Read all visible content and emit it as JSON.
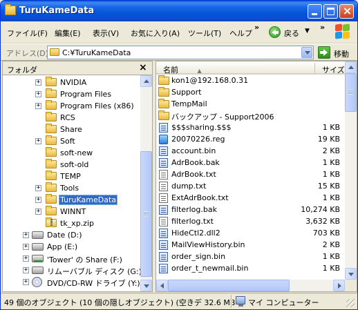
{
  "window": {
    "title": "TuruKameData"
  },
  "menubar": {
    "items": [
      "ファイル(F)",
      "編集(E)",
      "表示(V)",
      "お気に入り(A)",
      "ツール(T)",
      "ヘルプ"
    ],
    "more": "»",
    "back_label": "戻る",
    "back_drop": "▼",
    "more2": "»"
  },
  "addressbar": {
    "label": "アドレス(D)",
    "value": "C:¥TuruKameData",
    "go_label": "移動"
  },
  "folder_pane": {
    "title": "フォルダ",
    "close": "×",
    "items": [
      {
        "label": "NVIDIA",
        "expander": "+",
        "icon": "folder-icon"
      },
      {
        "label": "Program Files",
        "expander": "+",
        "icon": "folder-icon"
      },
      {
        "label": "Program Files (x86)",
        "expander": "+",
        "icon": "folder-icon"
      },
      {
        "label": "RCS",
        "expander": "",
        "icon": "folder-icon"
      },
      {
        "label": "Share",
        "expander": "",
        "icon": "folder-icon"
      },
      {
        "label": "Soft",
        "expander": "+",
        "icon": "folder-icon"
      },
      {
        "label": "soft-new",
        "expander": "",
        "icon": "folder-icon"
      },
      {
        "label": "soft-old",
        "expander": "",
        "icon": "folder-icon"
      },
      {
        "label": "TEMP",
        "expander": "",
        "icon": "folder-icon"
      },
      {
        "label": "Tools",
        "expander": "+",
        "icon": "folder-icon"
      },
      {
        "label": "TuruKameData",
        "expander": "+",
        "icon": "folder-icon",
        "selected": true
      },
      {
        "label": "WINNT",
        "expander": "+",
        "icon": "folder-icon"
      },
      {
        "label": "tk_xp.zip",
        "expander": "",
        "icon": "zip-folder-icon"
      },
      {
        "label": "Date (D:)",
        "expander": "+",
        "icon": "drive-icon"
      },
      {
        "label": "App (E:)",
        "expander": "+",
        "icon": "drive-icon"
      },
      {
        "label": "'Tower' の Share (F:)",
        "expander": "+",
        "icon": "network-drive-icon"
      },
      {
        "label": "リムーバブル ディスク (G:)",
        "expander": "+",
        "icon": "removable-drive-icon"
      },
      {
        "label": "DVD/CD-RW ドライブ (Y:)",
        "expander": "+",
        "icon": "cd-drive-icon"
      }
    ]
  },
  "file_list": {
    "columns": {
      "name": "名前",
      "sort_arrow": "▲",
      "size": "サイズ"
    },
    "rows": [
      {
        "name": "kon1@192.168.0.31",
        "size": "",
        "type": "folder"
      },
      {
        "name": "Support",
        "size": "",
        "type": "folder"
      },
      {
        "name": "TempMail",
        "size": "",
        "type": "folder"
      },
      {
        "name": "バックアップ - Support2006",
        "size": "",
        "type": "folder"
      },
      {
        "name": "$$$sharing.$$$",
        "size": "1 KB",
        "type": "app"
      },
      {
        "name": "20070226.reg",
        "size": "19 KB",
        "type": "reg"
      },
      {
        "name": "account.bin",
        "size": "2 KB",
        "type": "app"
      },
      {
        "name": "AdrBook.bak",
        "size": "1 KB",
        "type": "app"
      },
      {
        "name": "AdrBook.txt",
        "size": "1 KB",
        "type": "text"
      },
      {
        "name": "dump.txt",
        "size": "15 KB",
        "type": "text"
      },
      {
        "name": "ExtAdrBook.txt",
        "size": "1 KB",
        "type": "text"
      },
      {
        "name": "filterlog.bak",
        "size": "10,274 KB",
        "type": "app"
      },
      {
        "name": "filterlog.txt",
        "size": "3,632 KB",
        "type": "text"
      },
      {
        "name": "HideCtl2.dll2",
        "size": "703 KB",
        "type": "app"
      },
      {
        "name": "MailViewHistory.bin",
        "size": "2 KB",
        "type": "app"
      },
      {
        "name": "order_sign.bin",
        "size": "1 KB",
        "type": "app"
      },
      {
        "name": "order_t_newmail.bin",
        "size": "1 KB",
        "type": "app"
      }
    ]
  },
  "statusbar": {
    "left": "49 個のオブジェクト (10 個の隠しオブジェクト) (空きデ 32.6 MB",
    "right": "マイ コンピューター"
  }
}
